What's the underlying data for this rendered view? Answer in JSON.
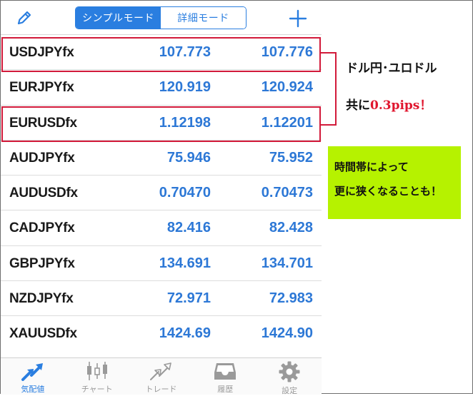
{
  "header": {
    "segment_simple": "シンプルモード",
    "segment_detail": "詳細モード"
  },
  "quotes": [
    {
      "symbol": "USDJPYfx",
      "bid": "107.773",
      "ask": "107.776"
    },
    {
      "symbol": "EURJPYfx",
      "bid": "120.919",
      "ask": "120.924"
    },
    {
      "symbol": "EURUSDfx",
      "bid": "1.12198",
      "ask": "1.12201"
    },
    {
      "symbol": "AUDJPYfx",
      "bid": "75.946",
      "ask": "75.952"
    },
    {
      "symbol": "AUDUSDfx",
      "bid": "0.70470",
      "ask": "0.70473"
    },
    {
      "symbol": "CADJPYfx",
      "bid": "82.416",
      "ask": "82.428"
    },
    {
      "symbol": "GBPJPYfx",
      "bid": "134.691",
      "ask": "134.701"
    },
    {
      "symbol": "NZDJPYfx",
      "bid": "72.971",
      "ask": "72.983"
    },
    {
      "symbol": "XAUUSDfx",
      "bid": "1424.69",
      "ask": "1424.90"
    }
  ],
  "tabs": [
    {
      "label": "気配値"
    },
    {
      "label": "チャート"
    },
    {
      "label": "トレード"
    },
    {
      "label": "履歴"
    },
    {
      "label": "設定"
    }
  ],
  "annotation1": {
    "line1": "ドル円･ユロドル",
    "line2_prefix": "共に",
    "line2_highlight": "0.3pips！"
  },
  "annotation2": {
    "line1": "時間帯によって",
    "line2": "更に狭くなることも！"
  },
  "colors": {
    "accent_blue": "#2a7ee0",
    "price_blue": "#2d78d6",
    "highlight_red": "#d21a3a",
    "note_green": "#b6f200"
  }
}
